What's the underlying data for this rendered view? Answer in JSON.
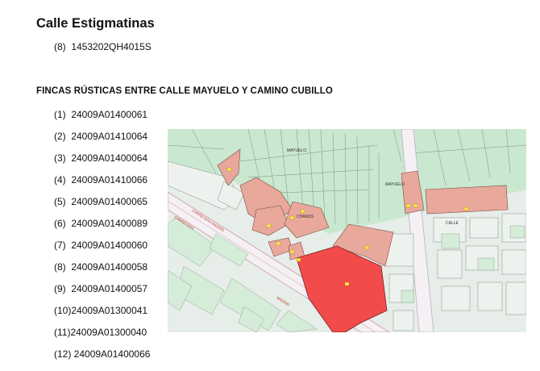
{
  "section1": {
    "title": "Calle Estigmatinas",
    "items": [
      "(8)  1453202QH4015S"
    ]
  },
  "section2": {
    "heading": "FINCAS RÚSTICAS ENTRE CALLE MAYUELO Y CAMINO CUBILLO",
    "items": [
      "(1)  24009A01400061",
      "(2)  24009A01410064",
      "(3)  24009A01400064",
      "(4)  24009A01410066",
      "(5)  24009A01400065",
      "(6)  24009A01400089",
      "(7)  24009A01400060",
      "(8)  24009A01400058",
      "(9)  24009A01400057",
      "(10)24009A01300041",
      "(11)24009A01300040",
      "(12) 24009A01400066"
    ]
  },
  "map": {
    "labels": {
      "mayuelo_top": "MAYUELO",
      "mayuelo_right": "MAYUELO",
      "carretera": "CARRETERA",
      "ctra_madrid": "CARRETERA  MADRID",
      "chanos": "CHANOS",
      "calle": "CALLE",
      "madrid": "MADRID"
    },
    "colors": {
      "field": "#c9e8cf",
      "urban": "#e7ede8",
      "road": "#f4f0f3",
      "parcel": "#e8a89c",
      "highlight": "#f24b4b"
    }
  }
}
